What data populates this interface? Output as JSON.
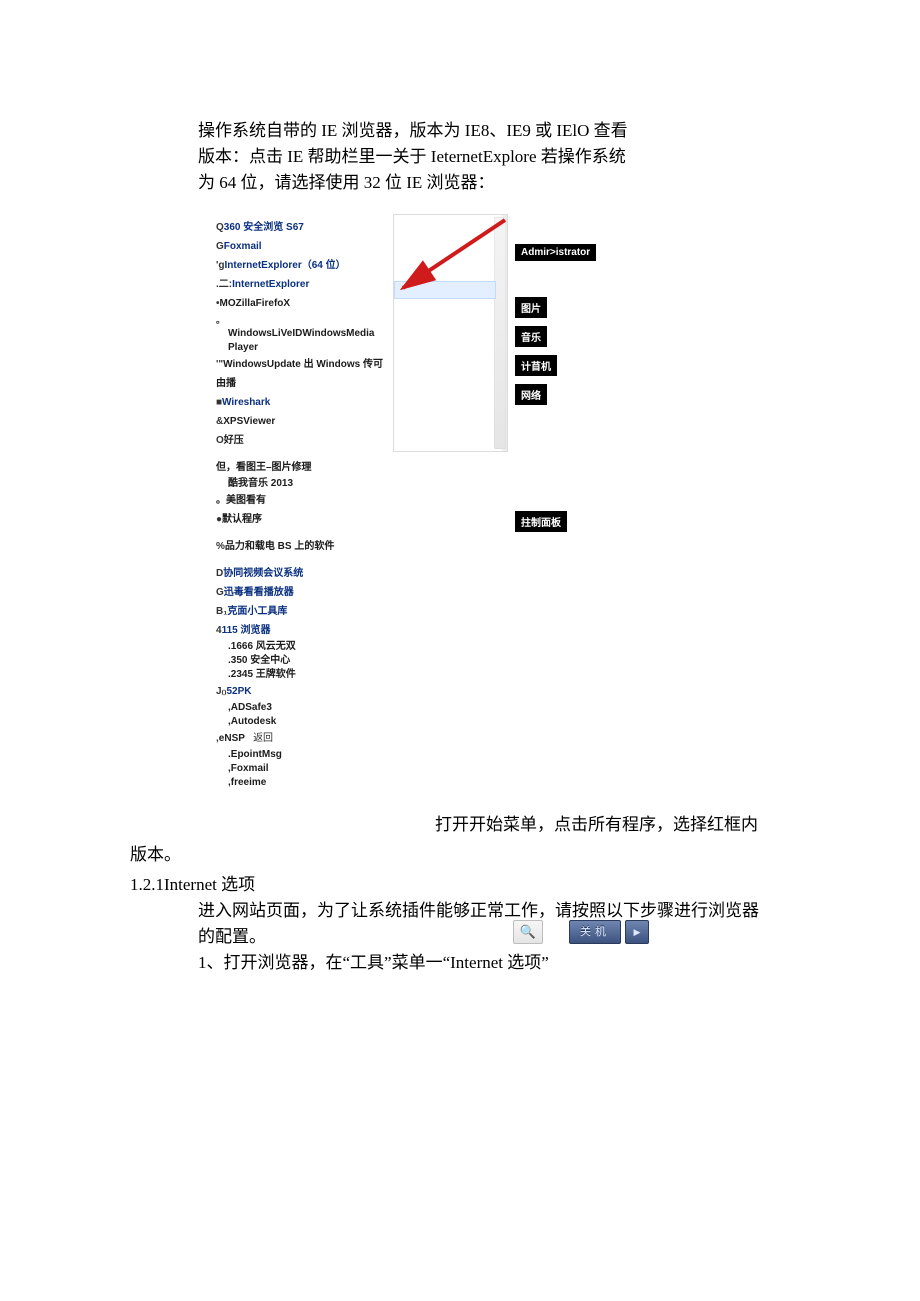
{
  "intro": {
    "line1": "操作系统自带的 IE 浏览器，版本为 IE8、IE9 或 IElO 查看",
    "line2": "版本：点击 IE 帮助栏里一关于 IeternetExplore 若操作系统",
    "line3": "为 64 位，请选择使用 32 位 IE 浏览器："
  },
  "start_menu": {
    "programs": [
      {
        "prefix": "Q",
        "text": "360 安全浏览 S67",
        "color": "blue"
      },
      {
        "prefix": "G",
        "text": "Foxmail",
        "color": "blue"
      },
      {
        "prefix": "'g",
        "text": "InternetExplorer（64 位）",
        "color": "blue"
      },
      {
        "prefix": ".二:",
        "text": "InternetExplorer",
        "color": "blue"
      },
      {
        "prefix": "•",
        "text": "MOZillaFirefoX",
        "color": "dark"
      },
      {
        "prefix": "。",
        "text": "",
        "color": "tiny"
      },
      {
        "subtext": "WindowsLiVeIDWindowsMedia",
        "indent": true
      },
      {
        "subtext": "Player",
        "indent": true
      },
      {
        "prefix": "'\"",
        "text": "WindowsUpdate 出 Windows 传可",
        "color": "dark"
      },
      {
        "text": "由播",
        "color": "dark"
      },
      {
        "prefix": "■",
        "text": "Wireshark",
        "color": "blue"
      },
      {
        "prefix": "&",
        "text": "XPSViewer",
        "color": "dark"
      },
      {
        "prefix": "O",
        "text": "好压",
        "color": "dark"
      },
      {
        "spacer": true
      },
      {
        "text": "但，看图王–图片修理",
        "color": "dark"
      },
      {
        "subtext": "酷我音乐 2013",
        "indent": true
      },
      {
        "prefix": "。",
        "text": "美图看有",
        "color": "dark"
      },
      {
        "prefix": "●",
        "text": "默认程序",
        "color": "dark"
      },
      {
        "spacer": true
      },
      {
        "prefix": "%",
        "text": "品力和载电 BS 上的软件",
        "color": "dark"
      },
      {
        "spacer": true
      },
      {
        "prefix": "D",
        "text": "协同视频会议系统",
        "color": "blue"
      },
      {
        "prefix": "G",
        "text": "迅毒看看播放器",
        "color": "blue"
      },
      {
        "prefix": "B₁",
        "text": "克面小工具库",
        "color": "blue"
      },
      {
        "prefix": "4",
        "text": "115 浏览器",
        "color": "blue"
      },
      {
        "subtext": ".1666 风云无双",
        "indent": true
      },
      {
        "subtext": ".350 安全中心",
        "indent": true
      },
      {
        "subtext": ".2345 王牌软件",
        "indent": true
      },
      {
        "prefix": "J₍₎",
        "text": "52PK",
        "color": "blue"
      },
      {
        "subtext": ",ADSafe3",
        "indent": true
      },
      {
        "subtext": ",Autodesk",
        "indent": true
      },
      {
        "prefix": ",",
        "text": "eNSP",
        "color": "dark",
        "suffix": "返回"
      },
      {
        "subtext": ".EpointMsg",
        "indent": true
      },
      {
        "subtext": ",Foxmail",
        "indent": true
      },
      {
        "subtext": ",freeime",
        "indent": true
      }
    ],
    "right_sidebar": {
      "user": "Admir>istrator",
      "items": [
        "图片",
        "音乐",
        "计苜机",
        "网络"
      ],
      "control_panel": "拄制面板"
    },
    "bottom": {
      "shutdown": "关机"
    }
  },
  "caption_after_figure": "打开开始菜单，点击所有程序，选择红框内",
  "after_fig_line": "版本。",
  "section_heading": "1.2.1Internet 选项",
  "body": {
    "line1": "进入网站页面，为了让系统插件能够正常工作，请按照以下步骤进行浏览器",
    "line2": "的配置。",
    "line3": "1、打开浏览器，在“工具”菜单一“Internet 选项”"
  }
}
